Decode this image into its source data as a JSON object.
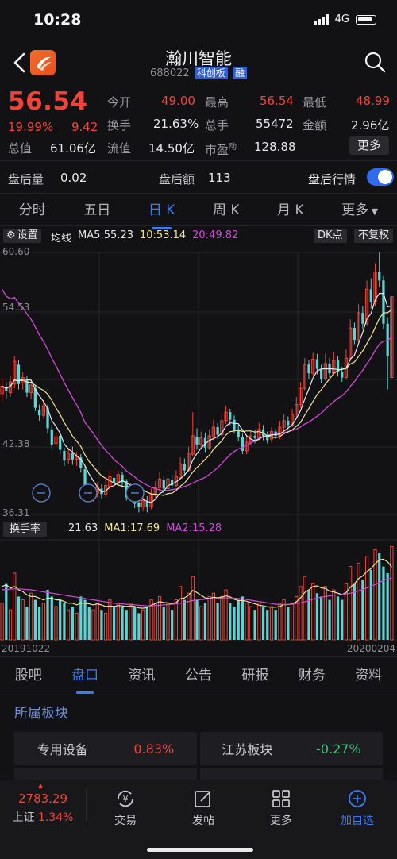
{
  "status": {
    "time": "10:28",
    "network": "4G"
  },
  "header": {
    "title": "瀚川智能",
    "code": "688022",
    "board_tag": "科创板",
    "margin_tag": "融"
  },
  "quote": {
    "price": "56.54",
    "change_pct": "19.99%",
    "change": "9.42",
    "open_label": "今开",
    "open": "49.00",
    "high_label": "最高",
    "high": "56.54",
    "low_label": "最低",
    "low": "48.99",
    "turnover_label": "换手",
    "turnover": "21.63%",
    "volume_label": "总手",
    "volume": "55472",
    "amount_label": "金额",
    "amount": "2.96亿",
    "mcap_label": "总值",
    "mcap": "61.06亿",
    "float_label": "流值",
    "float_cap": "14.50亿",
    "pe_label": "市盈",
    "pe_sup": "动",
    "pe": "128.88",
    "more_label": "更多"
  },
  "after_hours": {
    "vol_label": "盘后量",
    "vol": "0.02",
    "amt_label": "盘后额",
    "amt": "113",
    "toggle_label": "盘后行情",
    "toggle_on": true
  },
  "period_tabs": [
    "分时",
    "五日",
    "日 K",
    "周 K",
    "月 K",
    "更多"
  ],
  "chart_controls": {
    "settings_label": "设置",
    "ma_label": "均线",
    "ma5": "MA5:55.23",
    "ma10": "10:53.14",
    "ma20": "20:49.82",
    "dk_label": "DK点",
    "adjust_label": "不复权",
    "y_labels": [
      "60.60",
      "54.53",
      "42.38",
      "36.31"
    ],
    "vol_label": "换手率",
    "vol_value": "21.63",
    "vol_ma1": "MA1:17.69",
    "vol_ma2": "MA2:15.28",
    "date_start": "20191022",
    "date_end": "20200204"
  },
  "colors": {
    "up": "#f0443a",
    "down": "#5ad6d6",
    "ma5": "#e8e8ec",
    "ma10": "#f1e49a",
    "ma20": "#d04ad8",
    "accent": "#3b7cf5"
  },
  "chart_data": {
    "type": "candlestick",
    "x_range": [
      "20191022",
      "20200204"
    ],
    "ylim": [
      36.31,
      60.6
    ],
    "y_ticks": [
      60.6,
      54.53,
      42.38,
      36.31
    ],
    "ma": {
      "MA5": 55.23,
      "MA10": 53.14,
      "MA20": 49.82
    },
    "candles": [
      [
        47.5,
        48.2,
        46.8,
        49.0
      ],
      [
        48.0,
        47.8,
        47.0,
        48.6
      ],
      [
        47.6,
        48.6,
        47.2,
        49.2
      ],
      [
        48.4,
        50.5,
        48.0,
        51.0
      ],
      [
        50.2,
        48.4,
        47.9,
        50.6
      ],
      [
        48.5,
        49.0,
        47.9,
        49.5
      ],
      [
        48.8,
        47.6,
        47.2,
        49.2
      ],
      [
        47.6,
        48.3,
        47.0,
        48.8
      ],
      [
        48.0,
        46.2,
        45.9,
        48.3
      ],
      [
        46.0,
        45.5,
        45.0,
        46.5
      ],
      [
        45.5,
        46.3,
        45.2,
        46.9
      ],
      [
        46.2,
        44.3,
        43.8,
        46.5
      ],
      [
        44.2,
        42.8,
        42.4,
        44.6
      ],
      [
        42.9,
        43.5,
        42.5,
        44.0
      ],
      [
        43.6,
        42.3,
        41.9,
        43.9
      ],
      [
        42.2,
        41.3,
        40.8,
        42.5
      ],
      [
        41.4,
        42.0,
        41.0,
        42.5
      ],
      [
        42.0,
        41.4,
        40.9,
        42.6
      ],
      [
        41.4,
        41.7,
        40.8,
        42.1
      ],
      [
        41.6,
        40.6,
        40.2,
        41.9
      ],
      [
        40.5,
        38.5,
        38.0,
        40.8
      ],
      [
        38.6,
        38.0,
        37.6,
        39.0
      ],
      [
        38.0,
        38.4,
        37.5,
        38.9
      ],
      [
        38.3,
        38.8,
        37.9,
        39.3
      ],
      [
        38.7,
        38.2,
        37.8,
        39.1
      ],
      [
        38.2,
        39.0,
        37.9,
        39.5
      ],
      [
        38.9,
        39.8,
        38.6,
        40.4
      ],
      [
        39.7,
        39.2,
        38.9,
        40.2
      ],
      [
        39.3,
        40.0,
        38.9,
        40.4
      ],
      [
        40.0,
        39.3,
        38.8,
        40.3
      ],
      [
        39.4,
        37.9,
        37.6,
        39.6
      ],
      [
        38.0,
        38.7,
        37.7,
        39.2
      ],
      [
        38.7,
        37.3,
        36.9,
        38.9
      ],
      [
        37.4,
        37.0,
        36.5,
        37.8
      ],
      [
        37.0,
        37.6,
        36.6,
        38.2
      ],
      [
        37.5,
        37.0,
        36.5,
        38.0
      ],
      [
        37.0,
        38.2,
        36.8,
        38.7
      ],
      [
        38.1,
        38.8,
        37.8,
        39.4
      ],
      [
        38.8,
        39.6,
        38.4,
        40.2
      ],
      [
        39.5,
        38.7,
        38.2,
        39.8
      ],
      [
        38.7,
        39.6,
        38.5,
        40.1
      ],
      [
        39.5,
        39.0,
        38.6,
        40.0
      ],
      [
        39.0,
        39.8,
        38.8,
        40.4
      ],
      [
        39.7,
        41.0,
        39.5,
        41.6
      ],
      [
        41.0,
        40.4,
        40.0,
        41.5
      ],
      [
        40.4,
        42.0,
        40.2,
        42.6
      ],
      [
        41.9,
        43.6,
        41.7,
        45.8
      ],
      [
        43.5,
        42.8,
        42.3,
        44.3
      ],
      [
        42.8,
        43.4,
        42.5,
        44.0
      ],
      [
        43.4,
        42.5,
        42.1,
        43.9
      ],
      [
        42.5,
        43.6,
        42.3,
        44.2
      ],
      [
        43.5,
        44.4,
        43.2,
        45.1
      ],
      [
        44.4,
        43.7,
        43.3,
        44.8
      ],
      [
        43.7,
        45.0,
        43.5,
        45.6
      ],
      [
        45.0,
        45.8,
        44.7,
        46.4
      ],
      [
        45.8,
        45.1,
        44.6,
        46.1
      ],
      [
        45.1,
        44.2,
        43.8,
        45.5
      ],
      [
        44.2,
        43.5,
        43.1,
        44.6
      ],
      [
        43.5,
        42.2,
        41.9,
        43.8
      ],
      [
        42.2,
        43.0,
        41.9,
        43.6
      ],
      [
        43.0,
        43.6,
        42.7,
        44.1
      ],
      [
        43.6,
        43.4,
        42.9,
        44.2
      ],
      [
        43.4,
        44.2,
        43.2,
        44.8
      ],
      [
        44.2,
        43.6,
        43.2,
        44.6
      ],
      [
        43.6,
        43.2,
        42.9,
        44.0
      ],
      [
        43.3,
        44.0,
        43.0,
        44.4
      ],
      [
        44.0,
        43.6,
        43.3,
        44.3
      ],
      [
        43.6,
        44.4,
        43.3,
        45.0
      ],
      [
        44.4,
        45.0,
        44.1,
        45.6
      ],
      [
        45.0,
        44.6,
        44.2,
        45.4
      ],
      [
        44.6,
        45.6,
        44.4,
        46.1
      ],
      [
        45.6,
        46.5,
        45.3,
        47.2
      ],
      [
        46.5,
        48.0,
        46.2,
        48.6
      ],
      [
        48.0,
        50.2,
        47.8,
        50.8
      ],
      [
        50.2,
        49.4,
        48.9,
        50.6
      ],
      [
        49.4,
        50.7,
        49.1,
        51.3
      ],
      [
        50.7,
        49.8,
        49.3,
        51.2
      ],
      [
        49.8,
        48.9,
        48.5,
        50.2
      ],
      [
        48.9,
        50.3,
        48.7,
        51.2
      ],
      [
        50.3,
        49.4,
        49.0,
        50.8
      ],
      [
        49.4,
        50.6,
        49.2,
        51.4
      ],
      [
        50.6,
        49.5,
        49.1,
        51.0
      ],
      [
        49.5,
        49.0,
        48.6,
        50.0
      ],
      [
        49.0,
        50.8,
        48.8,
        51.6
      ],
      [
        50.8,
        53.6,
        50.5,
        54.4
      ],
      [
        53.6,
        52.5,
        52.1,
        54.1
      ],
      [
        52.5,
        55.0,
        52.2,
        55.8
      ],
      [
        55.0,
        54.0,
        53.5,
        55.6
      ],
      [
        54.0,
        57.2,
        53.8,
        58.0
      ],
      [
        57.2,
        56.0,
        55.4,
        58.2
      ],
      [
        56.0,
        58.8,
        55.6,
        59.6
      ],
      [
        58.8,
        58.0,
        57.4,
        60.6
      ],
      [
        58.0,
        54.0,
        53.5,
        58.4
      ],
      [
        54.0,
        51.0,
        47.9,
        54.6
      ],
      [
        49.0,
        56.5,
        49.0,
        56.5
      ]
    ],
    "turnover": [
      11,
      17,
      9,
      20,
      13,
      12,
      10,
      14,
      12,
      10,
      11,
      15,
      13,
      10,
      12,
      11,
      9,
      10,
      8,
      13,
      12,
      10,
      9,
      11,
      9,
      8,
      12,
      10,
      11,
      10,
      9,
      11,
      10,
      8,
      9,
      10,
      12,
      11,
      13,
      10,
      11,
      9,
      12,
      16,
      12,
      14,
      19,
      12,
      10,
      11,
      13,
      14,
      11,
      13,
      15,
      11,
      10,
      12,
      13,
      11,
      10,
      9,
      11,
      10,
      9,
      10,
      9,
      11,
      12,
      10,
      11,
      13,
      16,
      19,
      15,
      17,
      14,
      13,
      16,
      12,
      15,
      13,
      12,
      17,
      22,
      17,
      23,
      18,
      25,
      21,
      27,
      26,
      22,
      20,
      28
    ],
    "ma1": [
      16,
      16.5,
      15.5,
      16,
      15,
      14.5,
      13.5,
      13,
      13,
      12.5,
      12,
      12.5,
      12.5,
      12,
      12,
      11.5,
      11,
      11,
      10.5,
      11,
      11,
      10.8,
      10.5,
      10.8,
      10.5,
      10,
      10.2,
      10,
      10.3,
      10.2,
      10,
      10.2,
      10,
      9.6,
      9.5,
      9.7,
      10.4,
      10.9,
      11.5,
      11.2,
      11.1,
      10.8,
      11.2,
      12.3,
      12.6,
      13.4,
      14.8,
      14.2,
      13.4,
      12.6,
      12.4,
      12.8,
      12.6,
      12.8,
      13.2,
      12.9,
      12.2,
      11.8,
      11.8,
      11.6,
      11.2,
      10.8,
      10.4,
      10.2,
      9.9,
      9.8,
      9.8,
      10,
      10.6,
      10.6,
      10.8,
      11.4,
      12.6,
      14.2,
      15,
      16,
      16.2,
      15.6,
      15.4,
      14.6,
      14.4,
      14,
      13.6,
      14.2,
      15.8,
      16.8,
      18.4,
      19.2,
      20.5,
      21.4,
      22.8,
      24,
      24.2,
      23.4,
      21.8
    ],
    "ma2": [
      15,
      15.1,
      15.2,
      15.3,
      15.3,
      15.2,
      15.1,
      15,
      14.8,
      14.6,
      14.4,
      14.2,
      14,
      13.8,
      13.6,
      13.4,
      13.2,
      13,
      12.8,
      12.6,
      12.4,
      12.2,
      12,
      11.8,
      11.6,
      11.4,
      11.2,
      11,
      10.9,
      10.8,
      10.7,
      10.6,
      10.5,
      10.4,
      10.3,
      10.2,
      10.2,
      10.3,
      10.4,
      10.5,
      10.6,
      10.7,
      10.8,
      11,
      11.2,
      11.5,
      11.8,
      12,
      12.1,
      12.2,
      12.3,
      12.4,
      12.4,
      12.5,
      12.6,
      12.6,
      12.5,
      12.4,
      12.3,
      12.1,
      11.9,
      11.7,
      11.5,
      11.3,
      11.1,
      10.9,
      10.7,
      10.6,
      10.6,
      10.6,
      10.7,
      10.9,
      11.1,
      11.4,
      11.8,
      12.2,
      12.6,
      12.8,
      13,
      13.2,
      13.4,
      13.5,
      13.6,
      13.8,
      14,
      14.3,
      14.7,
      15.1,
      15.6,
      16.1,
      16.6,
      17.2,
      17.8,
      18.3,
      18.6
    ]
  },
  "sub_tabs": [
    "股吧",
    "盘口",
    "资讯",
    "公告",
    "研报",
    "财务",
    "资料"
  ],
  "sector": {
    "title": "所属板块",
    "cards": [
      {
        "name": "专用设备",
        "pct": "0.83%",
        "dir": "up"
      },
      {
        "name": "江苏板块",
        "pct": "-0.27%",
        "dir": "down"
      }
    ]
  },
  "bottom_bar": {
    "index_value": "2783.29",
    "index_name": "上证",
    "index_pct": "1.34%",
    "items": [
      "交易",
      "发帖",
      "更多",
      "加自选"
    ]
  }
}
